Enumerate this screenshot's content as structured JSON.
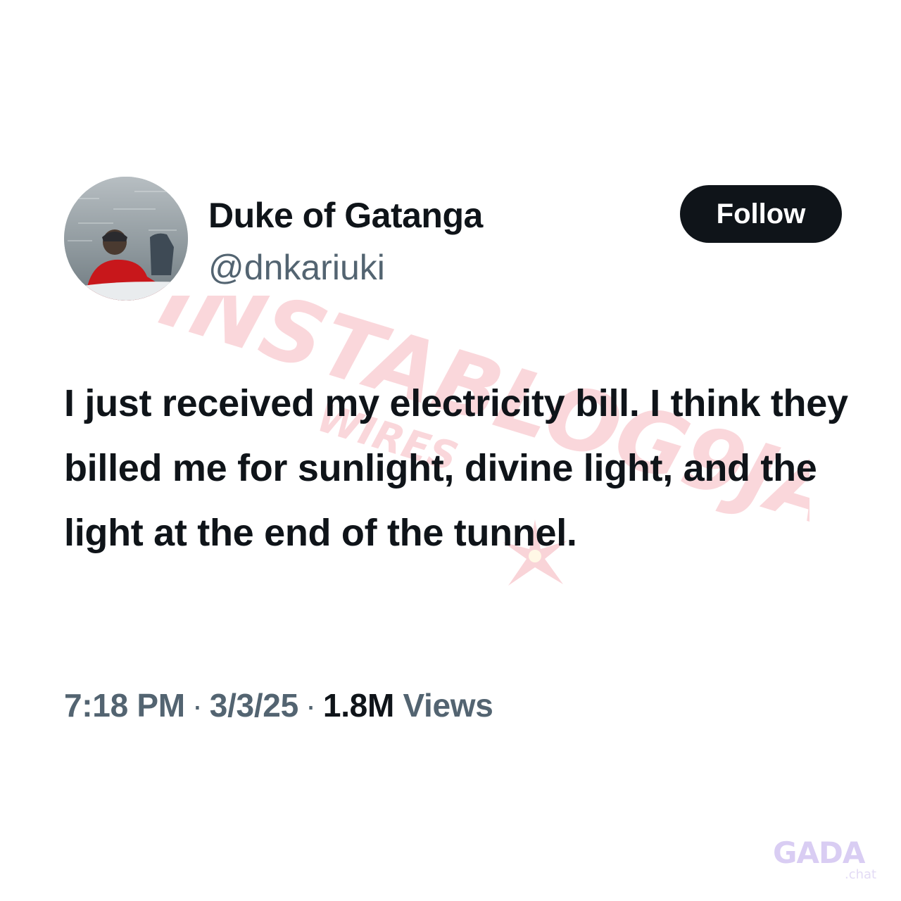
{
  "author": {
    "display_name": "Duke of Gatanga",
    "handle": "@dnkariuki"
  },
  "follow_button": {
    "label": "Follow"
  },
  "tweet": {
    "text": "I just received my electricity bill. I think they billed me for sunlight, divine light, and the light at the end of the tunnel."
  },
  "meta": {
    "time": "7:18 PM",
    "separator": "·",
    "date": "3/3/25",
    "views_count": "1.8M",
    "views_label": "Views"
  },
  "watermark": {
    "line1": "INSTABLOG9JA",
    "line2": "WIRES"
  },
  "corner_logo": {
    "brand": "GADA",
    "suffix": ".chat"
  },
  "colors": {
    "text_primary": "#0f1419",
    "text_secondary": "#536471",
    "button_bg": "#0f1419",
    "button_text": "#ffffff",
    "watermark": "#f6b8bf",
    "logo": "#d9cdf3"
  }
}
